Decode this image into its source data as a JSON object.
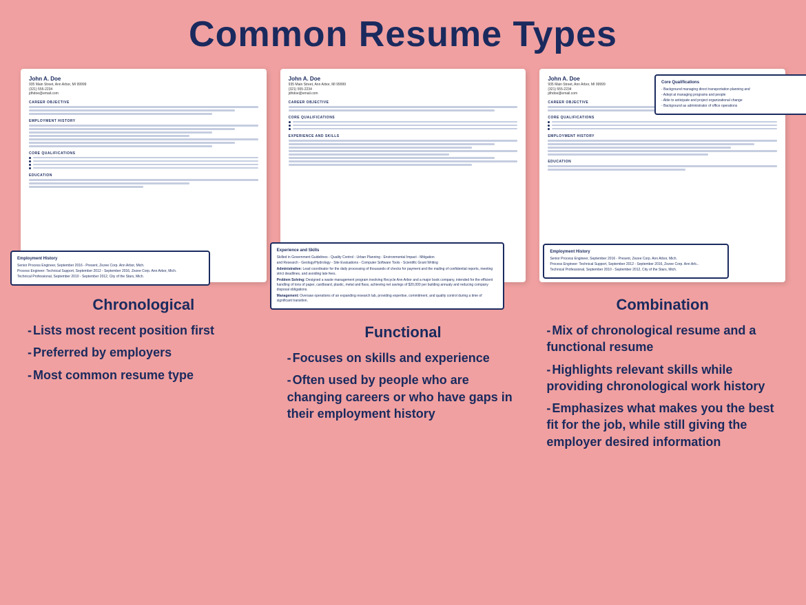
{
  "page": {
    "title": "Common Resume Types",
    "bg_color": "#f0a0a0"
  },
  "columns": [
    {
      "id": "chronological",
      "title": "Chronological",
      "items": [
        "-Lists most recent position first",
        "-Preferred by employers",
        "-Most common resume type"
      ],
      "callout": {
        "title": "Employment History",
        "lines": [
          "Senior Process Engineer, September 2016 - Present, Zezee Corp. Ann Arbor, Mich.",
          "Process Engineer: Technical Support, September 2012 - September 2016, Zezee Corp. Ann Arbor, Mich.",
          "Technical Professional, September 2010 - September 2012, City of the Stars, Mich."
        ]
      }
    },
    {
      "id": "functional",
      "title": "Functional",
      "items": [
        "-Focuses on skills and experience",
        "-Often used by people who are changing careers or who have gaps in their employment history"
      ],
      "callout": {
        "title": "Experience and Skills",
        "lines": [
          "Skilled in Government Guidelines - Quality Control - Urban Planning - Environmental Impact - Mitigation",
          "and Research - Geology/Hydrology - Site Evaluations - Computer Software Tools - Scientific Grant Writing",
          "Administrative: Lead coordinator for the daily processing of thousands of checks for payment and the",
          "mailing of confidential reports, meeting strict deadlines, and avoiding late fees.",
          "Problem Solving: Designed a waste management program involving Recycle Ann Arbor and a major book",
          "company, intended for the efficient handling of tons of paper, cardboard, plastic, metal and flass,",
          "achieving net savings of $20,000 per building annualy and reducing company disposal obligations.",
          "Management: Oversaw operations of an expanding research lab, providing expertise, commitment, and",
          "quality control during a time of significant transition."
        ]
      }
    },
    {
      "id": "combination",
      "title": "Combination",
      "items": [
        "-Mix of chronological resume and a functional resume",
        "-Highlights relevant skills while providing chronological work history",
        "-Emphasizes what makes you the best fit for the job, while still giving the employer desired information"
      ],
      "callout_emp": {
        "title": "Employment History",
        "lines": [
          "Senior Process Engineer, September 2016 - Present, Zezee Corp. Ann Arbor, Mich.",
          "Process Engineer: Technical Support, September 2012 - September 2016, Zezee Corp. Ann Arb...",
          "Technical Professional, September 2010 - September 2012, City of the Stars, Mich."
        ]
      },
      "callout_core": {
        "title": "Core Qualifications",
        "lines": [
          "- Background managing direct transportation planning and",
          "- Adept at managing programs and people",
          "- Able to anticipate and project organizational change",
          "- Background as administrator of office operations"
        ]
      }
    }
  ]
}
